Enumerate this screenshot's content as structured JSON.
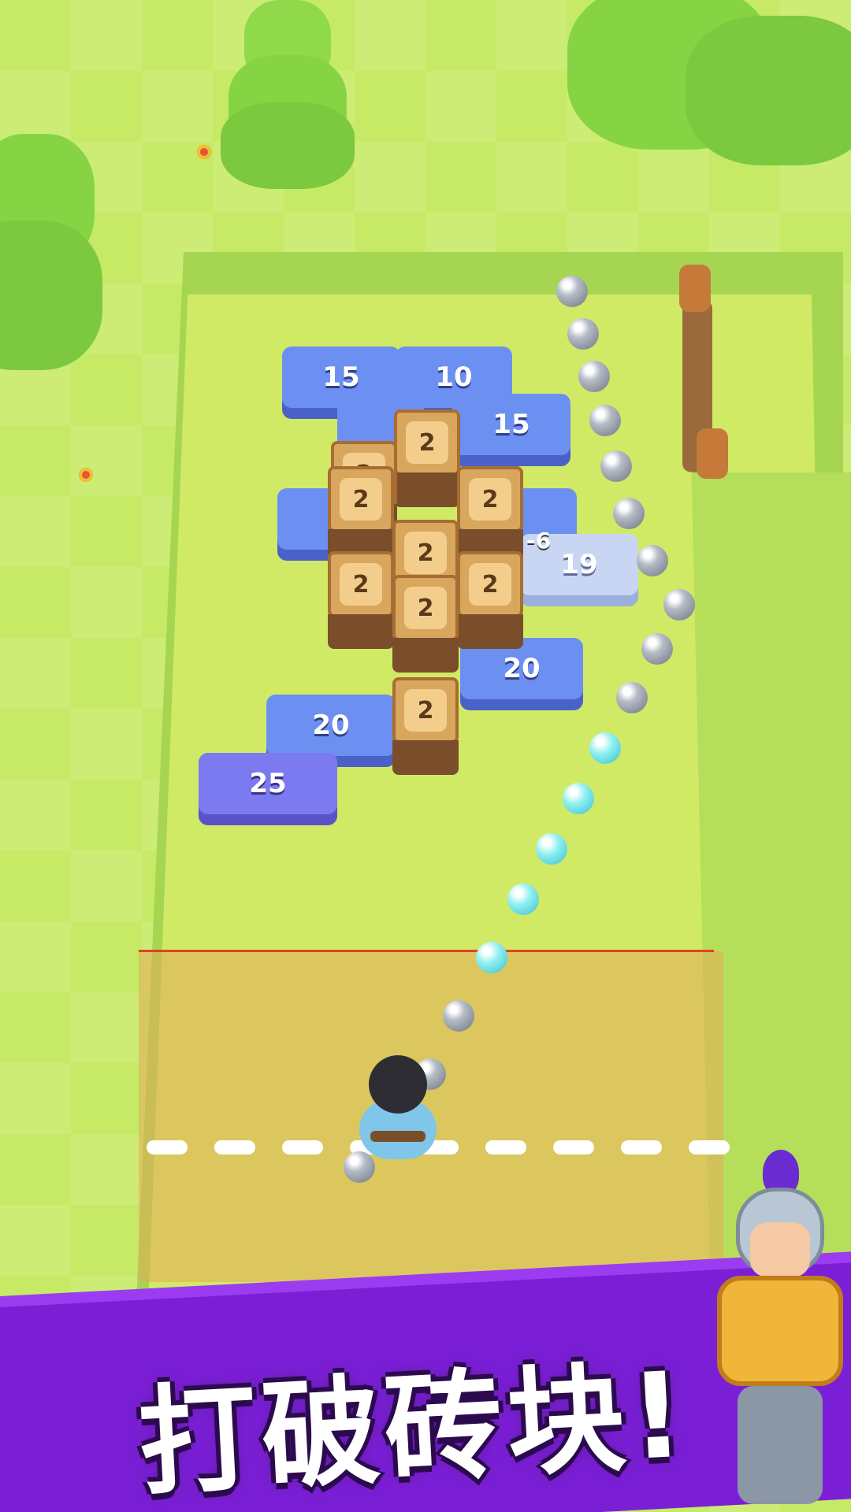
{
  "game": {
    "banner_text": "打破砖块!",
    "bricks": [
      {
        "label": "15",
        "tone": "blue"
      },
      {
        "label": "10",
        "tone": "blue"
      },
      {
        "label": "15",
        "tone": "blue"
      },
      {
        "label": "19",
        "tone": "pale"
      },
      {
        "label": "20",
        "tone": "blue"
      },
      {
        "label": "20",
        "tone": "blue"
      },
      {
        "label": "25",
        "tone": "purple"
      }
    ],
    "crates": [
      {
        "label": "2"
      },
      {
        "label": "2"
      },
      {
        "label": "2"
      },
      {
        "label": "2"
      },
      {
        "label": "2"
      },
      {
        "label": "2"
      },
      {
        "label": "2"
      },
      {
        "label": "2"
      },
      {
        "label": "2"
      }
    ],
    "damage_popup": "-6"
  },
  "colors": {
    "banner": "#7b1fd6",
    "brick_blue": "#6c8ff2",
    "brick_purple": "#7c7af0",
    "grass": "#c6ea66",
    "crate": "#d9a65e"
  },
  "icons": {
    "player": "hero-character-icon",
    "mascot": "knight-character-icon",
    "projectile": "ball-icon"
  }
}
